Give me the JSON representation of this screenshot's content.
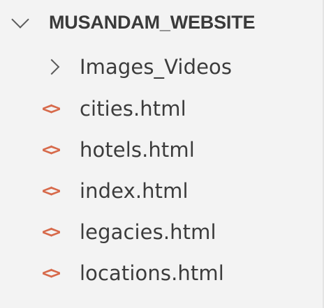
{
  "explorer": {
    "root": {
      "label": "MUSANDAM_WEBSITE",
      "icon": "chevron-down-icon"
    },
    "items": [
      {
        "type": "folder",
        "label": "Images_Videos",
        "icon": "chevron-right-icon"
      },
      {
        "type": "file",
        "label": "cities.html",
        "icon_glyph": "<>",
        "icon": "html-file-icon"
      },
      {
        "type": "file",
        "label": "hotels.html",
        "icon_glyph": "<>",
        "icon": "html-file-icon"
      },
      {
        "type": "file",
        "label": "index.html",
        "icon_glyph": "<>",
        "icon": "html-file-icon"
      },
      {
        "type": "file",
        "label": "legacies.html",
        "icon_glyph": "<>",
        "icon": "html-file-icon"
      },
      {
        "type": "file",
        "label": "locations.html",
        "icon_glyph": "<>",
        "icon": "html-file-icon"
      }
    ],
    "colors": {
      "background": "#f3f3f3",
      "text": "#3c3c3c",
      "html_icon": "#d76a4b"
    }
  }
}
